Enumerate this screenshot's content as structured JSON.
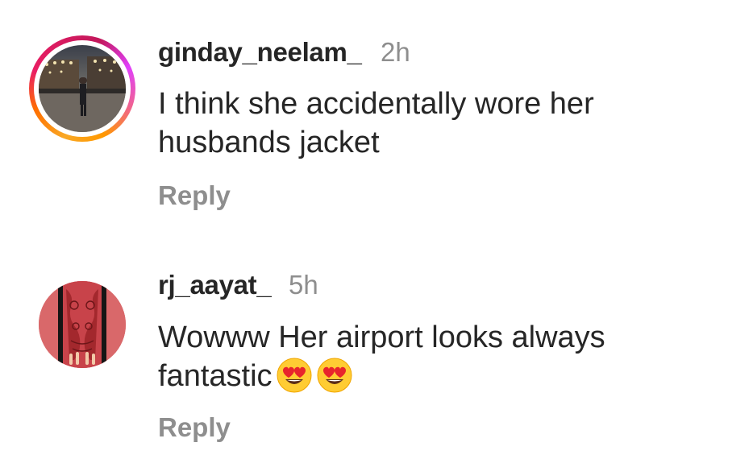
{
  "comments": [
    {
      "username": "ginday_neelam_",
      "time": "2h",
      "text_line1": "I think she accidentally wore her",
      "text_line2": "husbands jacket",
      "reply_label": "Reply",
      "avatar_has_story_ring": true,
      "avatar_icon": "profile-photo-city-night"
    },
    {
      "username": "rj_aayat_",
      "time": "5h",
      "text_line1": "Wowww Her airport looks always",
      "text_line2": "fantastic",
      "emojis": [
        "heart-eyes-emoji",
        "heart-eyes-emoji"
      ],
      "reply_label": "Reply",
      "avatar_has_story_ring": false,
      "avatar_icon": "profile-photo-henna-hands"
    }
  ],
  "colors": {
    "username": "#262626",
    "secondary_text": "#8e8e8e",
    "ring_gradient": [
      "#f9a825",
      "#e91e63",
      "#e040fb"
    ],
    "avatar2_bg": "#d9686a"
  }
}
